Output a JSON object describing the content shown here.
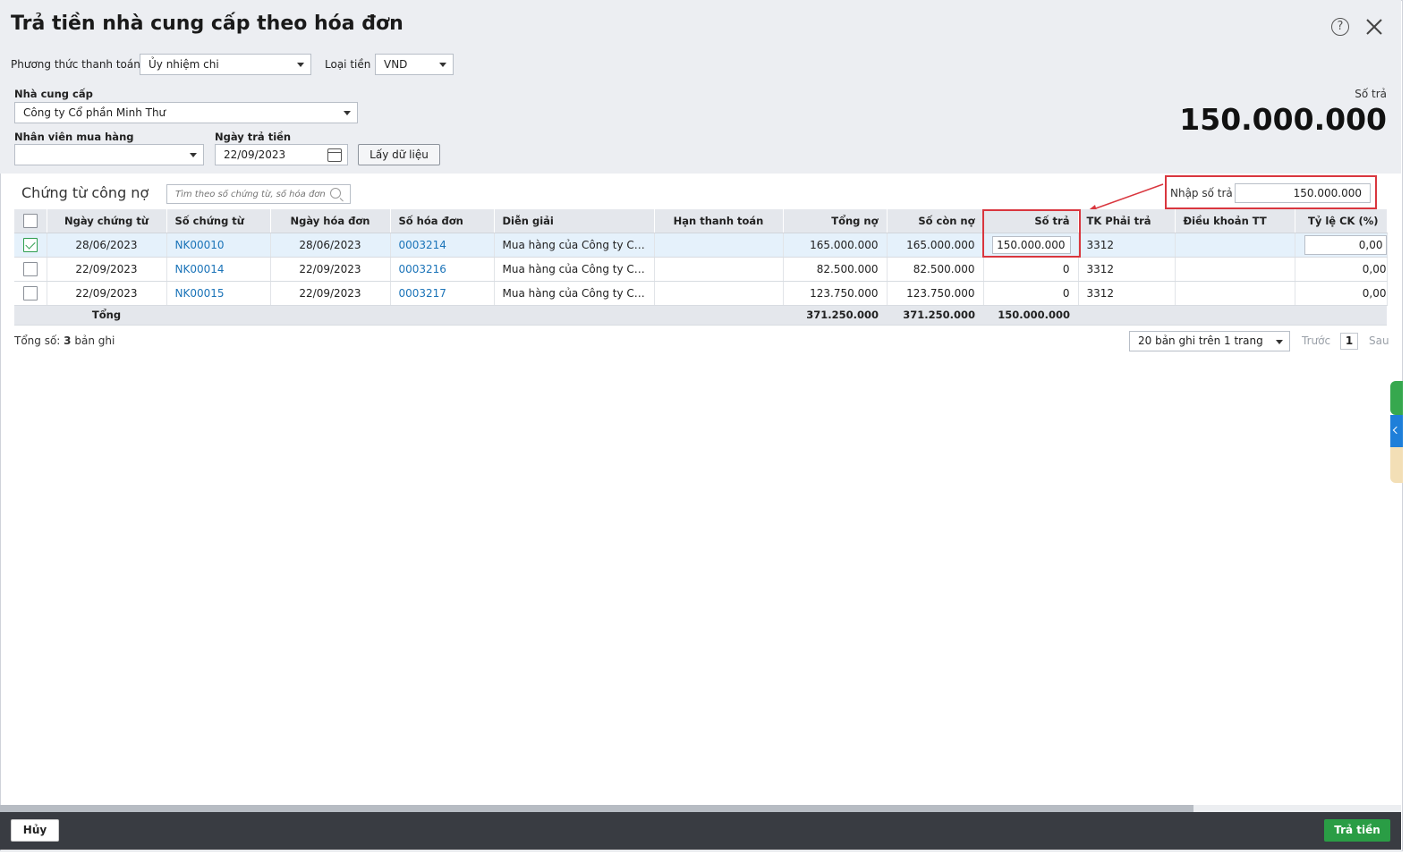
{
  "dialog": {
    "title": "Trả tiền nhà cung cấp theo hóa đơn"
  },
  "filters": {
    "payment_method_label": "Phương thức thanh toán",
    "payment_method_value": "Ủy nhiệm chi",
    "currency_label": "Loại tiền",
    "currency_value": "VND",
    "supplier_label": "Nhà cung cấp",
    "supplier_value": "Công ty Cổ phần Minh Thư",
    "purchaser_label": "Nhân viên mua hàng",
    "purchaser_value": "",
    "pay_date_label": "Ngày trả tiền",
    "pay_date_value": "22/09/2023",
    "fetch_button": "Lấy dữ liệu"
  },
  "summary": {
    "amount_label": "Số trả",
    "amount_value": "150.000.000"
  },
  "section": {
    "title": "Chứng từ công nợ",
    "search_placeholder": "Tìm theo số chứng từ, số hóa đơn",
    "enter_amount_label": "Nhập số trả",
    "enter_amount_value": "150.000.000"
  },
  "table": {
    "columns": [
      "Ngày chứng từ",
      "Số chứng từ",
      "Ngày hóa đơn",
      "Số hóa đơn",
      "Diễn giải",
      "Hạn thanh toán",
      "Tổng nợ",
      "Số còn nợ",
      "Số trả",
      "TK Phải trả",
      "Điều khoản TT",
      "Tỷ lệ CK (%)"
    ],
    "rows": [
      {
        "checked": true,
        "voucher_date": "28/06/2023",
        "voucher_no": "NK00010",
        "invoice_date": "28/06/2023",
        "invoice_no": "0003214",
        "description": "Mua hàng của Công ty Cổ phần Minh Thư",
        "due_date": "",
        "total_debt": "165.000.000",
        "remaining": "165.000.000",
        "paid": "150.000.000",
        "account": "3312",
        "terms": "",
        "discount": "0,00"
      },
      {
        "checked": false,
        "voucher_date": "22/09/2023",
        "voucher_no": "NK00014",
        "invoice_date": "22/09/2023",
        "invoice_no": "0003216",
        "description": "Mua hàng của Công ty Cổ phần Minh Thư",
        "due_date": "",
        "total_debt": "82.500.000",
        "remaining": "82.500.000",
        "paid": "0",
        "account": "3312",
        "terms": "",
        "discount": "0,00"
      },
      {
        "checked": false,
        "voucher_date": "22/09/2023",
        "voucher_no": "NK00015",
        "invoice_date": "22/09/2023",
        "invoice_no": "0003217",
        "description": "Mua hàng của Công ty Cổ phần Minh Thư",
        "due_date": "",
        "total_debt": "123.750.000",
        "remaining": "123.750.000",
        "paid": "0",
        "account": "3312",
        "terms": "",
        "discount": "0,00"
      }
    ],
    "footer": {
      "label": "Tổng",
      "total_debt": "371.250.000",
      "remaining": "371.250.000",
      "paid": "150.000.000"
    }
  },
  "pager": {
    "total_prefix": "Tổng số: ",
    "total_count": "3",
    "total_suffix": " bản ghi",
    "page_size": "20 bản ghi trên 1 trang",
    "prev": "Trước",
    "page": "1",
    "next": "Sau"
  },
  "footer": {
    "cancel": "Hủy",
    "pay": "Trả tiền"
  },
  "colors": {
    "accent_green": "#2a9d45",
    "highlight_red": "#d9363e",
    "link_blue": "#1a73b8"
  }
}
